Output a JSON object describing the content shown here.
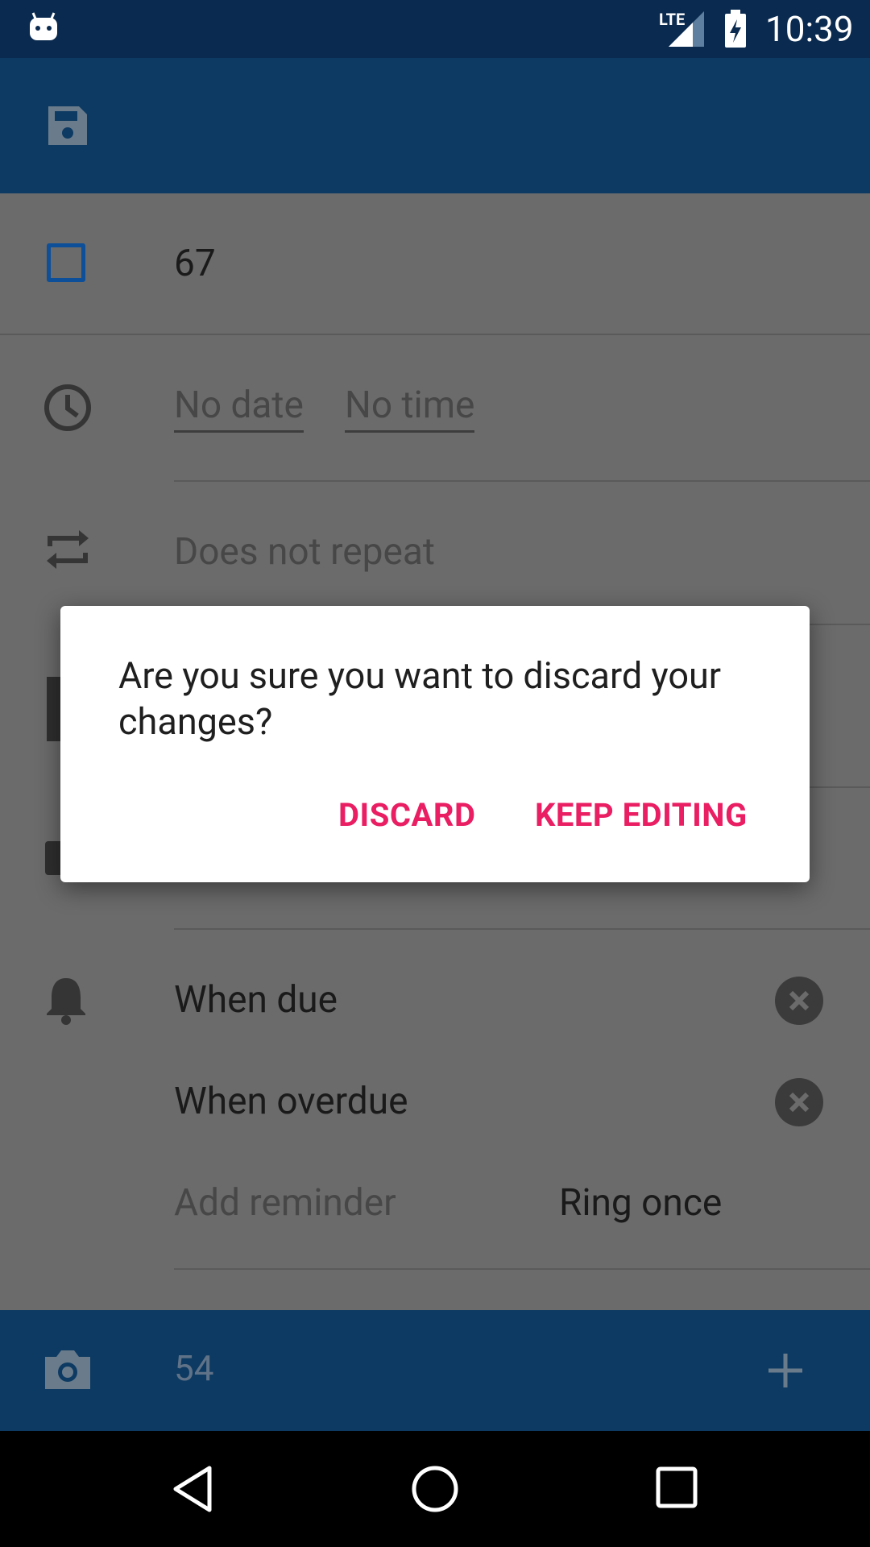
{
  "status_bar": {
    "network": "LTE",
    "time": "10:39"
  },
  "toolbar": {
    "save_icon": "save-icon"
  },
  "task": {
    "title": "67",
    "date_placeholder": "No date",
    "time_placeholder": "No time",
    "repeat": "Does not repeat"
  },
  "reminders": {
    "items": [
      {
        "label": "When due",
        "remove_icon": "remove-circle-icon"
      },
      {
        "label": "When overdue",
        "remove_icon": "remove-circle-icon"
      }
    ],
    "add_label": "Add reminder",
    "ring_mode": "Ring once"
  },
  "bottom_bar": {
    "comment_value": "54",
    "camera_icon": "camera-icon",
    "add_icon": "plus-icon"
  },
  "dialog": {
    "message": "Are you sure you want to discard your changes?",
    "discard_label": "DISCARD",
    "keep_label": "KEEP EDITING"
  },
  "colors": {
    "accent": "#e91e63",
    "toolbar": "#0d3a62",
    "status_bar": "#0a2a4f",
    "checkbox": "#1565c0"
  }
}
